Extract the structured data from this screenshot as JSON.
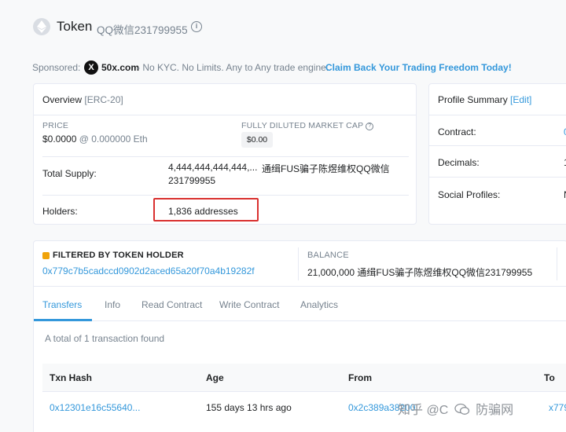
{
  "header": {
    "title": "Token",
    "subtitle": "QQ微信231799955",
    "info_glyph": "i"
  },
  "sponsored": {
    "label": "Sponsored:",
    "brand_glyph": "X",
    "brand": "50x.com",
    "description": "- No KYC. No Limits. Any to Any trade engine.",
    "cta": "Claim Back Your Trading Freedom Today!"
  },
  "overview": {
    "title": "Overview",
    "standard": "[ERC-20]",
    "price_label": "PRICE",
    "price_value": "$0.0000",
    "price_eth": "@ 0.000000 Eth",
    "market_cap_label": "FULLY DILUTED MARKET CAP",
    "market_cap_help": "?",
    "market_cap_value": "$0.00",
    "total_supply_label": "Total Supply:",
    "total_supply_value": "4,444,444,444,444,...",
    "total_supply_token": "通缉FUS骗子陈煜维权QQ微信",
    "total_supply_token_2": "231799955",
    "holders_label": "Holders:",
    "holders_value": "1,836 addresses"
  },
  "profile": {
    "title": "Profile Summary",
    "edit": "[Edit]",
    "contract_label": "Contract:",
    "contract_value": "0",
    "decimals_label": "Decimals:",
    "decimals_value": "1",
    "social_label": "Social Profiles:",
    "social_value": "N"
  },
  "filter": {
    "header": "FILTERED BY TOKEN HOLDER",
    "address": "0x779c7b5cadccd0902d2aced65a20f70a4b19282f",
    "balance_label": "BALANCE",
    "balance_value": "21,000,000 通缉FUS骗子陈煜维权QQ微信231799955"
  },
  "tabs": [
    "Transfers",
    "Info",
    "Read Contract",
    "Write Contract",
    "Analytics"
  ],
  "transactions": {
    "summary": "A total of 1 transaction found",
    "columns": [
      "Txn Hash",
      "Age",
      "From",
      "To"
    ],
    "rows": [
      {
        "hash": "0x12301e16c55640...",
        "age": "155 days 13 hrs ago",
        "from": "0x2c389a38200",
        "to": "x779"
      }
    ]
  },
  "watermark": {
    "left": "知乎 @C",
    "right": "防骗网"
  },
  "colors": {
    "link": "#3498db",
    "highlight_border": "#d9302f",
    "token_badge": "#f0a30a"
  }
}
